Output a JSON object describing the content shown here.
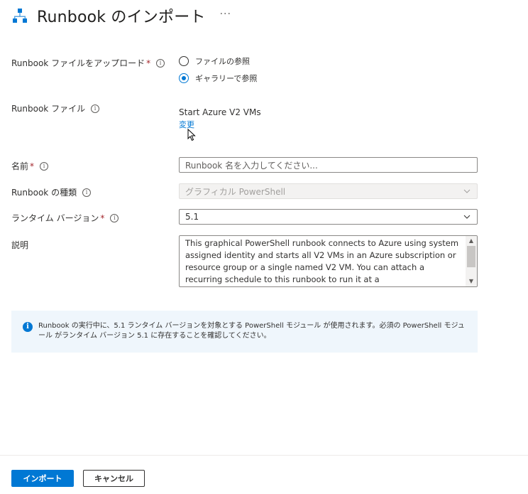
{
  "header": {
    "title": "Runbook のインポート",
    "more": "···",
    "icon": "runbook-hierarchy-icon"
  },
  "upload": {
    "label": "Runbook ファイルをアップロード",
    "required": "*",
    "options": [
      "ファイルの参照",
      "ギャラリーで参照"
    ],
    "selected": "ギャラリーで参照"
  },
  "file": {
    "label": "Runbook ファイル",
    "name": "Start Azure V2 VMs",
    "change_link": "変更"
  },
  "name_field": {
    "label": "名前",
    "required": "*",
    "placeholder": "Runbook 名を入力してください..."
  },
  "type_field": {
    "label": "Runbook の種類",
    "value": "グラフィカル PowerShell"
  },
  "runtime_field": {
    "label": "ランタイム バージョン",
    "required": "*",
    "value": "5.1"
  },
  "description_field": {
    "label": "説明",
    "value": "This graphical PowerShell runbook connects to Azure using system assigned identity and starts all V2 VMs in an Azure subscription or resource group or a single named V2 VM. You can attach a recurring schedule to this runbook to run it at a"
  },
  "infobar": {
    "message": "Runbook の実行中に、5.1 ランタイム バージョンを対象とする PowerShell モジュール が使用されます。必須の PowerShell モジュール がランタイム バージョン 5.1 に存在することを確認してください。"
  },
  "footer": {
    "import_label": "インポート",
    "cancel_label": "キャンセル"
  },
  "colors": {
    "accent": "#0078d4",
    "required": "#a4262c",
    "infobar_bg": "#eff6fc"
  }
}
